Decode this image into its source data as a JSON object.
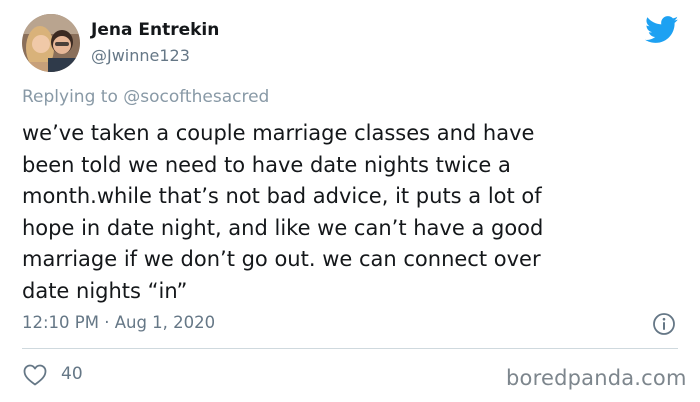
{
  "tweet": {
    "author_name": "Jena Entrekin",
    "author_handle": "@Jwinne123",
    "replying_to": "Replying to @socofthesacred",
    "body_lines": [
      "we’ve taken a couple marriage classes and have",
      "been told we need to have date nights twice a",
      "month.while that’s not bad advice, it puts a lot of",
      "hope in date night, and like we can’t have a good",
      "marriage if we don’t go out. we can connect over",
      "date nights “in”"
    ],
    "timestamp": "12:10 PM · Aug 1, 2020",
    "like_count": "40"
  },
  "watermark": "boredpanda.com",
  "icons": {
    "brand": "twitter-bird-icon",
    "info": "info-icon",
    "like": "heart-icon"
  },
  "colors": {
    "twitter_blue": "#1da1f2",
    "secondary_text": "#657786",
    "primary_text": "#14171a"
  }
}
